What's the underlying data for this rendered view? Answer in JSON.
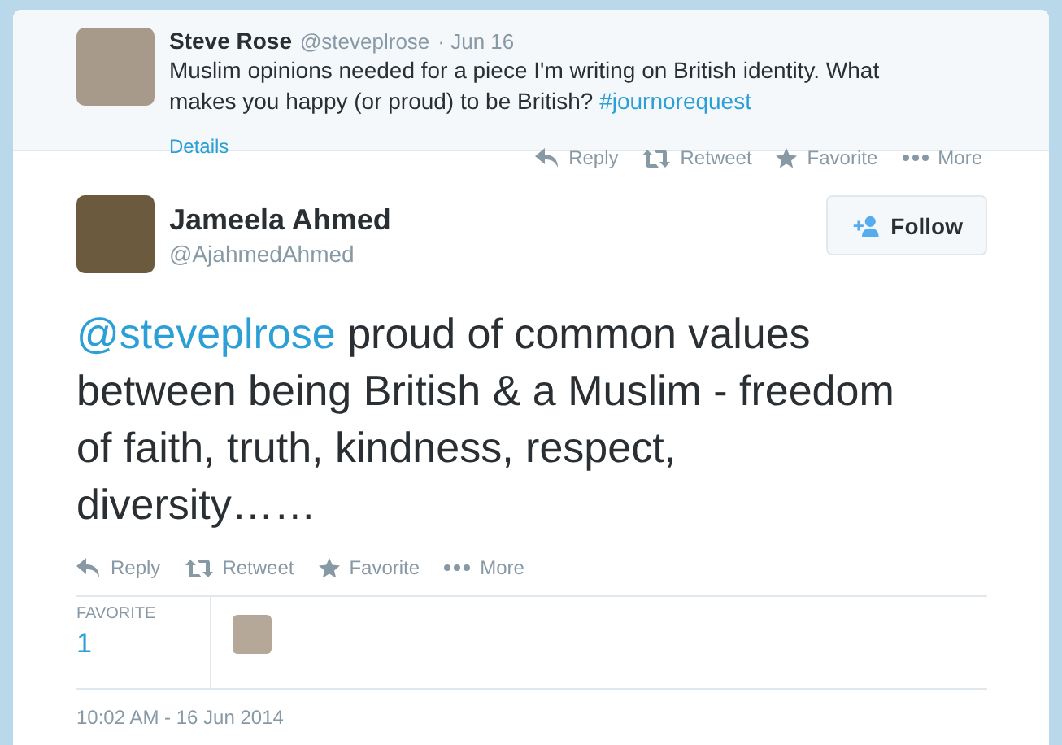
{
  "parent_tweet": {
    "name": "Steve Rose",
    "handle": "@steveplrose",
    "date": "· Jun 16",
    "text": [
      {
        "kind": "plain",
        "text": "Muslim opinions needed for a piece I'm writing on British identity. What makes you happy (or proud) to be British? "
      },
      {
        "kind": "link",
        "text": "#journorequest"
      }
    ],
    "details": "Details",
    "actions": [
      {
        "kind": "reply",
        "label": "Reply"
      },
      {
        "kind": "retweet",
        "label": "Retweet"
      },
      {
        "kind": "favorite",
        "label": "Favorite"
      },
      {
        "kind": "more",
        "label": "More"
      }
    ]
  },
  "tweet": {
    "name": "Jameela Ahmed",
    "handle": "@AjahmedAhmed",
    "follow_button": "Follow",
    "text": [
      {
        "kind": "link",
        "text": "@steveplrose"
      },
      {
        "kind": "plain",
        "text": " proud of common values between being British & a Muslim - freedom of faith, truth, kindness, respect, diversity……"
      }
    ],
    "actions": [
      {
        "kind": "reply",
        "label": "Reply"
      },
      {
        "kind": "retweet",
        "label": "Retweet"
      },
      {
        "kind": "favorite",
        "label": "Favorite"
      },
      {
        "kind": "more",
        "label": "More"
      }
    ],
    "stats": {
      "label": "FAVORITE",
      "count": "1"
    },
    "timestamp": "10:02 AM - 16 Jun 2014"
  }
}
